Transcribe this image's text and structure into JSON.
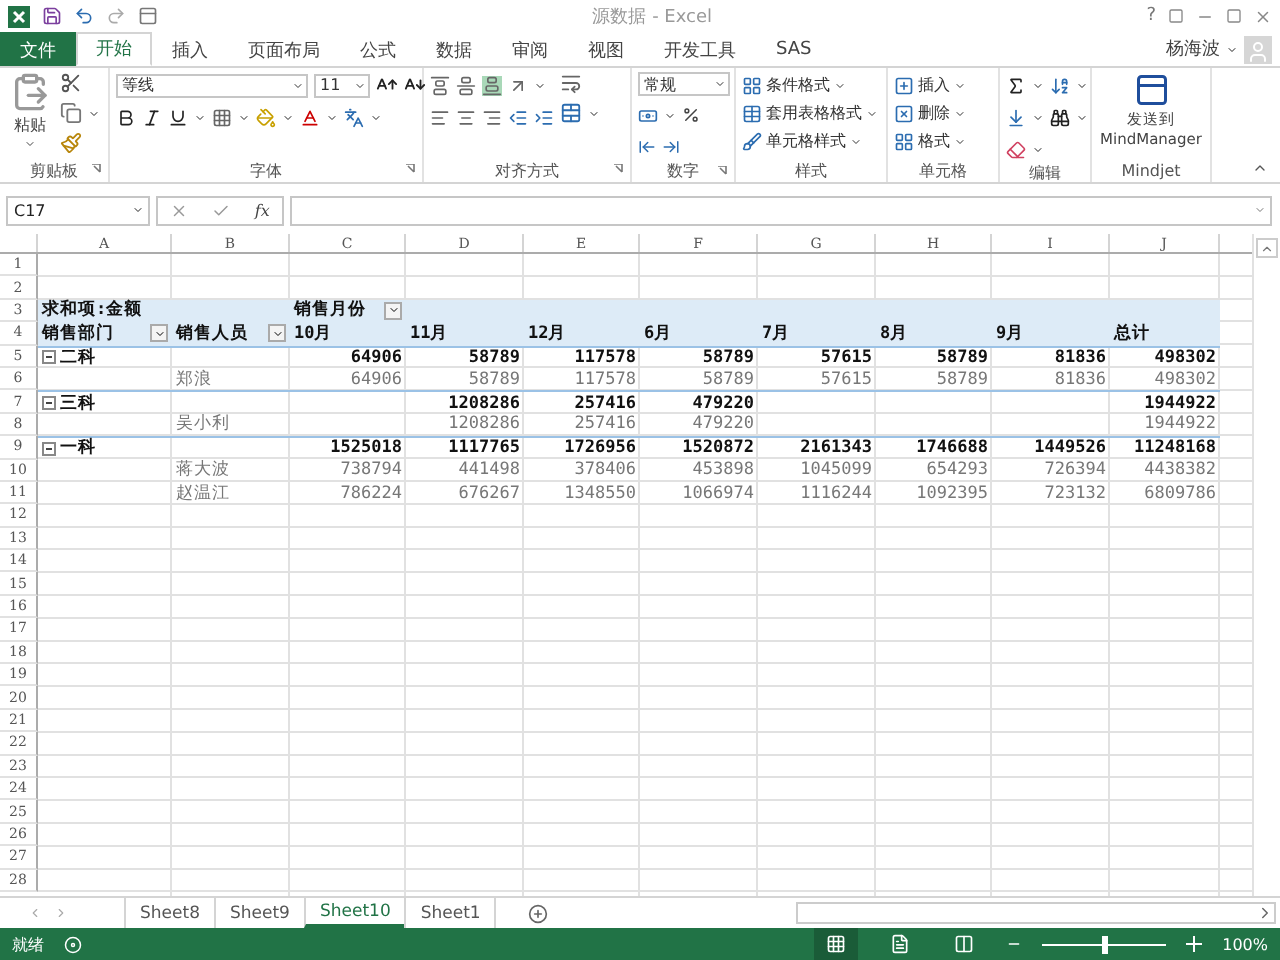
{
  "window": {
    "title": "源数据 - Excel",
    "help": "?"
  },
  "ribbon_tabs": [
    {
      "label": "文件",
      "kind": "file",
      "selected": false
    },
    {
      "label": "开始",
      "kind": "tab",
      "selected": true
    },
    {
      "label": "插入",
      "kind": "tab",
      "selected": false
    },
    {
      "label": "页面布局",
      "kind": "tab",
      "selected": false
    },
    {
      "label": "公式",
      "kind": "tab",
      "selected": false
    },
    {
      "label": "数据",
      "kind": "tab",
      "selected": false
    },
    {
      "label": "审阅",
      "kind": "tab",
      "selected": false
    },
    {
      "label": "视图",
      "kind": "tab",
      "selected": false
    },
    {
      "label": "开发工具",
      "kind": "tab",
      "selected": false
    },
    {
      "label": "SAS",
      "kind": "tab",
      "selected": false
    }
  ],
  "user": {
    "name": "杨海波"
  },
  "ribbon": {
    "groups": [
      {
        "label": "剪贴板",
        "kind": "clipboard",
        "paste": "粘贴"
      },
      {
        "label": "字体",
        "kind": "font",
        "font": "等线",
        "size": "11"
      },
      {
        "label": "对齐方式",
        "kind": "align"
      },
      {
        "label": "数字",
        "kind": "number",
        "format": "常规"
      },
      {
        "label": "样式",
        "kind": "list",
        "items": [
          "条件格式",
          "套用表格格式",
          "单元格样式"
        ]
      },
      {
        "label": "单元格",
        "kind": "list",
        "items": [
          "插入",
          "删除",
          "格式"
        ]
      },
      {
        "label": "编辑",
        "kind": "edit"
      },
      {
        "label": "Mindjet",
        "kind": "big",
        "text": "发送到 MindManager"
      }
    ]
  },
  "formula_bar": {
    "name_box": "C17",
    "function_label": "fx"
  },
  "columns": [
    "A",
    "B",
    "C",
    "D",
    "E",
    "F",
    "G",
    "H",
    "I",
    "J"
  ],
  "rows": [
    {
      "number": "1",
      "kind": "blank"
    },
    {
      "number": "2",
      "kind": "blank"
    },
    {
      "number": "3",
      "kind": "header",
      "cells": [
        {
          "text": "求和项:金额"
        },
        null,
        {
          "text": "销售月份",
          "filter": true
        },
        null,
        null,
        null,
        null,
        null,
        null,
        null
      ]
    },
    {
      "number": "4",
      "kind": "header",
      "cells": [
        {
          "text": "销售部门",
          "filter": true
        },
        {
          "text": "销售人员",
          "filter": true
        },
        {
          "text": "10月"
        },
        {
          "text": "11月"
        },
        {
          "text": "12月"
        },
        {
          "text": "6月"
        },
        {
          "text": "7月"
        },
        {
          "text": "8月"
        },
        {
          "text": "9月"
        },
        {
          "text": "总计"
        }
      ]
    },
    {
      "number": "5",
      "kind": "group",
      "cells": [
        {
          "text": "二科",
          "expanded": true
        },
        null,
        {
          "text": "64906"
        },
        {
          "text": "58789"
        },
        {
          "text": "117578"
        },
        {
          "text": "58789"
        },
        {
          "text": "57615"
        },
        {
          "text": "58789"
        },
        {
          "text": "81836"
        },
        {
          "text": "498302"
        }
      ]
    },
    {
      "number": "6",
      "kind": "detail",
      "cells": [
        null,
        {
          "text": "郑浪"
        },
        {
          "text": "64906"
        },
        {
          "text": "58789"
        },
        {
          "text": "117578"
        },
        {
          "text": "58789"
        },
        {
          "text": "57615"
        },
        {
          "text": "58789"
        },
        {
          "text": "81836"
        },
        {
          "text": "498302"
        }
      ]
    },
    {
      "number": "7",
      "kind": "group",
      "cells": [
        {
          "text": "三科",
          "expanded": true
        },
        null,
        null,
        {
          "text": "1208286"
        },
        {
          "text": "257416"
        },
        {
          "text": "479220"
        },
        null,
        null,
        null,
        {
          "text": "1944922"
        }
      ]
    },
    {
      "number": "8",
      "kind": "detail",
      "cells": [
        null,
        {
          "text": "吴小利"
        },
        null,
        {
          "text": "1208286"
        },
        {
          "text": "257416"
        },
        {
          "text": "479220"
        },
        null,
        null,
        null,
        {
          "text": "1944922"
        }
      ]
    },
    {
      "number": "9",
      "kind": "group",
      "cells": [
        {
          "text": "一科",
          "expanded": true
        },
        null,
        {
          "text": "1525018"
        },
        {
          "text": "1117765"
        },
        {
          "text": "1726956"
        },
        {
          "text": "1520872"
        },
        {
          "text": "2161343"
        },
        {
          "text": "1746688"
        },
        {
          "text": "1449526"
        },
        {
          "text": "11248168"
        }
      ]
    },
    {
      "number": "10",
      "kind": "detail",
      "cells": [
        null,
        {
          "text": "蒋大波"
        },
        {
          "text": "738794"
        },
        {
          "text": "441498"
        },
        {
          "text": "378406"
        },
        {
          "text": "453898"
        },
        {
          "text": "1045099"
        },
        {
          "text": "654293"
        },
        {
          "text": "726394"
        },
        {
          "text": "4438382"
        }
      ]
    },
    {
      "number": "11",
      "kind": "detail",
      "cells": [
        null,
        {
          "text": "赵温江"
        },
        {
          "text": "786224"
        },
        {
          "text": "676267"
        },
        {
          "text": "1348550"
        },
        {
          "text": "1066974"
        },
        {
          "text": "1116244"
        },
        {
          "text": "1092395"
        },
        {
          "text": "723132"
        },
        {
          "text": "6809786"
        }
      ]
    },
    {
      "number": "12",
      "kind": "blank"
    },
    {
      "number": "13",
      "kind": "blank"
    },
    {
      "number": "14",
      "kind": "blank"
    },
    {
      "number": "15",
      "kind": "blank"
    },
    {
      "number": "16",
      "kind": "blank"
    },
    {
      "number": "17",
      "kind": "blank"
    },
    {
      "number": "18",
      "kind": "blank"
    },
    {
      "number": "19",
      "kind": "blank"
    },
    {
      "number": "20",
      "kind": "blank"
    },
    {
      "number": "21",
      "kind": "blank"
    },
    {
      "number": "22",
      "kind": "blank"
    },
    {
      "number": "23",
      "kind": "blank"
    },
    {
      "number": "24",
      "kind": "blank"
    },
    {
      "number": "25",
      "kind": "blank"
    },
    {
      "number": "26",
      "kind": "blank"
    },
    {
      "number": "27",
      "kind": "blank"
    },
    {
      "number": "28",
      "kind": "blank"
    }
  ],
  "sheet_tabs": [
    {
      "label": "Sheet8",
      "selected": false
    },
    {
      "label": "Sheet9",
      "selected": false
    },
    {
      "label": "Sheet10",
      "selected": true
    },
    {
      "label": "Sheet1",
      "selected": false
    }
  ],
  "status_bar": {
    "status": "就绪",
    "zoom": {
      "level": 0.5,
      "reading": "100%"
    }
  }
}
